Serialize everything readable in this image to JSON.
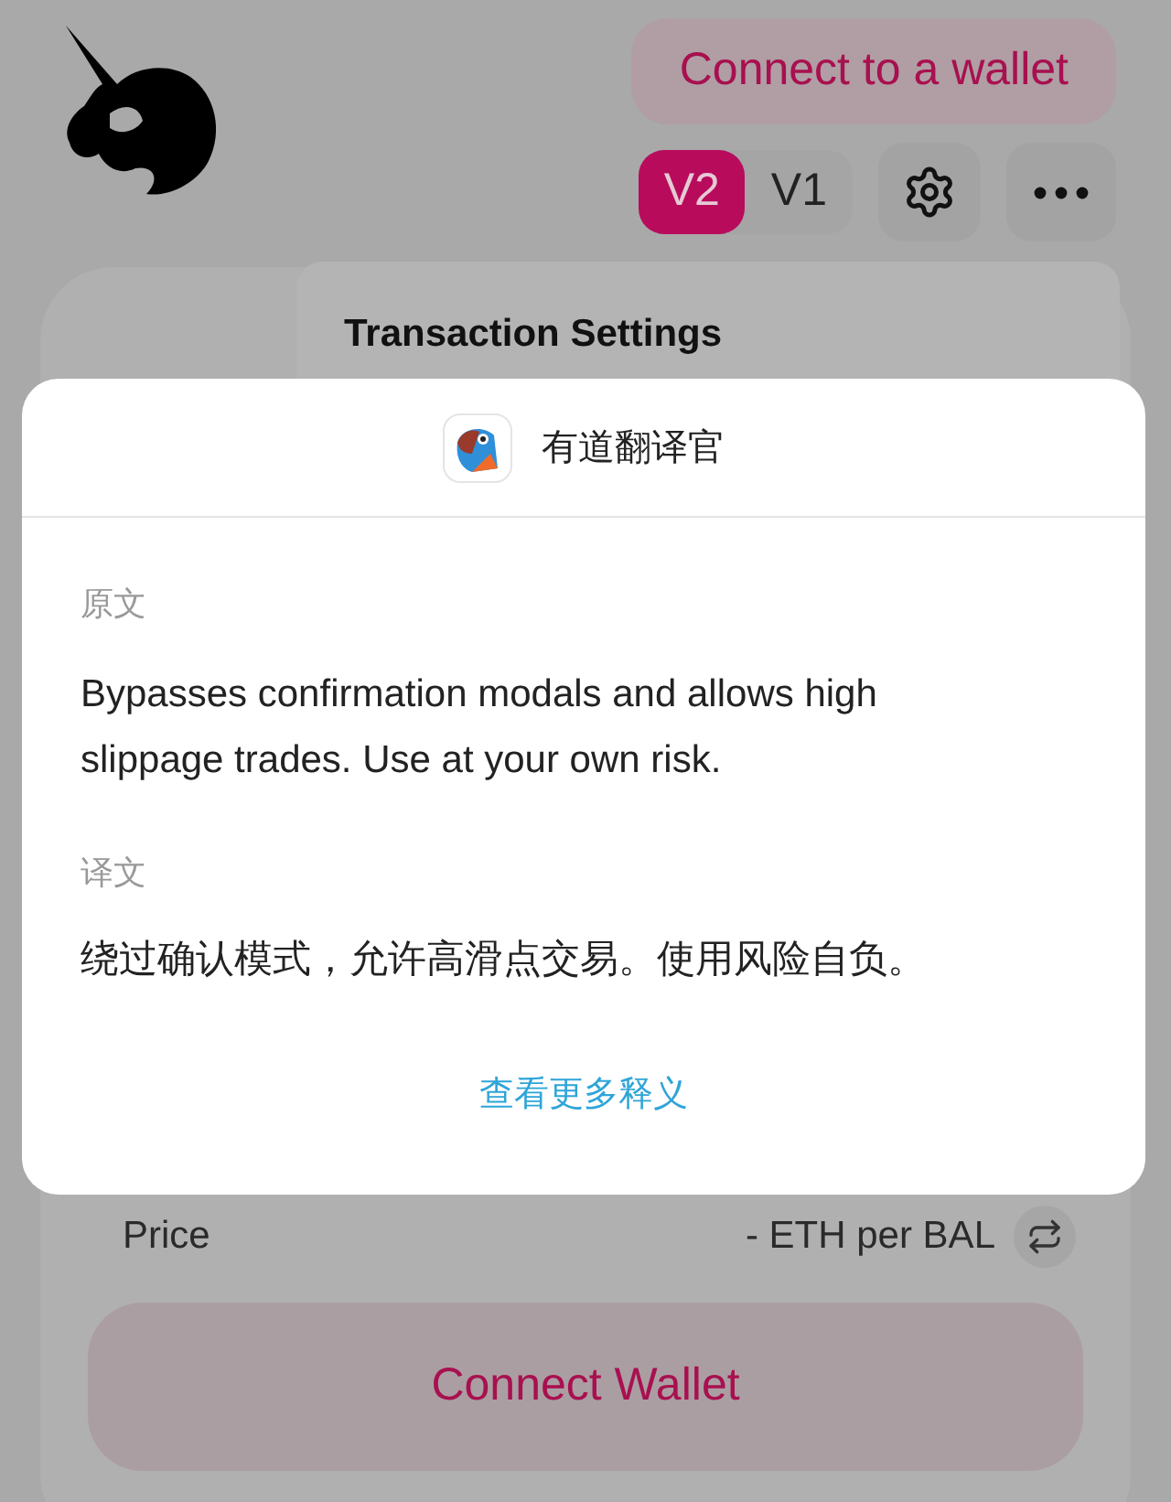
{
  "header": {
    "connect_button": "Connect to a wallet",
    "versions": [
      {
        "label": "V2",
        "selected": true
      },
      {
        "label": "V1",
        "selected": false
      }
    ]
  },
  "settings_popover": {
    "title": "Transaction Settings"
  },
  "translator": {
    "app_name": "有道翻译官",
    "source_label": "原文",
    "source_text": "Bypasses confirmation modals and allows high slippage trades. Use at your own risk.",
    "target_label": "译文",
    "target_text": "绕过确认模式，允许高滑点交易。使用风险自负。",
    "more_link": "查看更多释义"
  },
  "swap": {
    "price_label": "Price",
    "price_value": "- ETH per BAL",
    "button": "Connect Wallet"
  }
}
